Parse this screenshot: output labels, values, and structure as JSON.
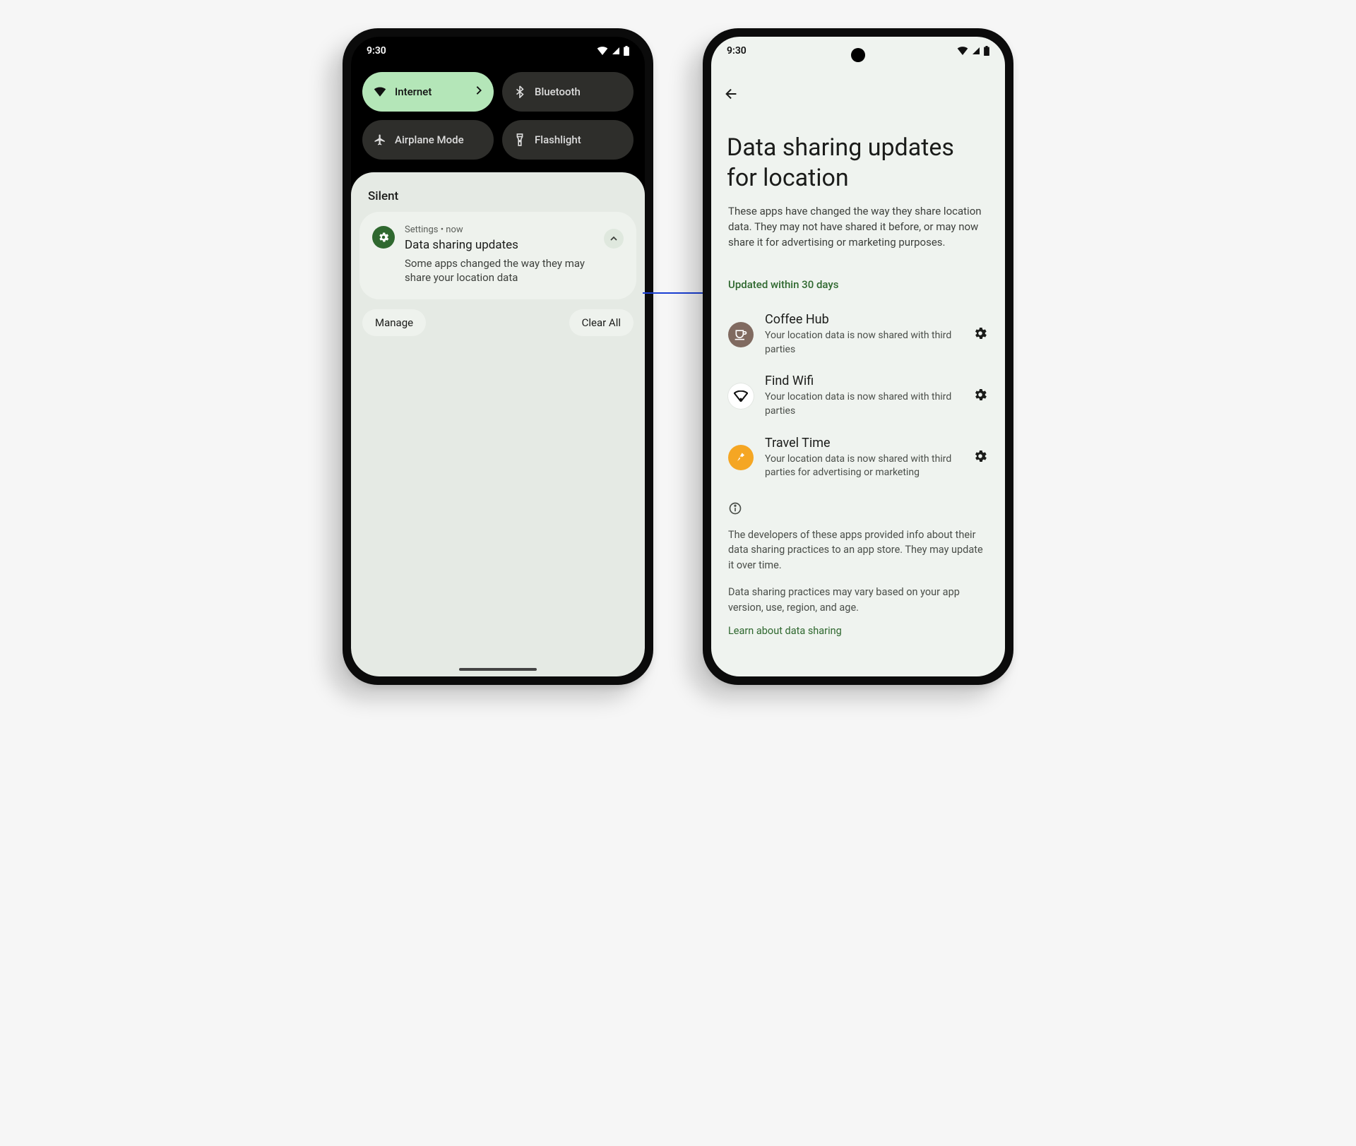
{
  "statusbar": {
    "time": "9:30"
  },
  "qs": {
    "internet": "Internet",
    "bluetooth": "Bluetooth",
    "airplane": "Airplane Mode",
    "flashlight": "Flashlight"
  },
  "shade": {
    "section": "Silent",
    "notif": {
      "app": "Settings  •  now",
      "title": "Data sharing updates",
      "body": "Some apps changed the way they may share your location data"
    },
    "manage": "Manage",
    "clearAll": "Clear All"
  },
  "settings": {
    "title": "Data sharing updates for location",
    "desc": "These apps have changed the way they share location data. They may not have shared it before, or may now share it for advertising or marketing purposes.",
    "subheader": "Updated within 30 days",
    "apps": [
      {
        "name": "Coffee Hub",
        "sub": "Your location data is now shared with third parties"
      },
      {
        "name": "Find Wifi",
        "sub": "Your location data is now shared with third parties"
      },
      {
        "name": "Travel Time",
        "sub": "Your location data is now shared with third parties for advertising or marketing"
      }
    ],
    "info1": "The developers of these apps provided info about their data sharing practices to an app store. They may update it over time.",
    "info2": "Data sharing practices may vary based on your app version, use, region, and age.",
    "learn": "Learn about data sharing"
  }
}
